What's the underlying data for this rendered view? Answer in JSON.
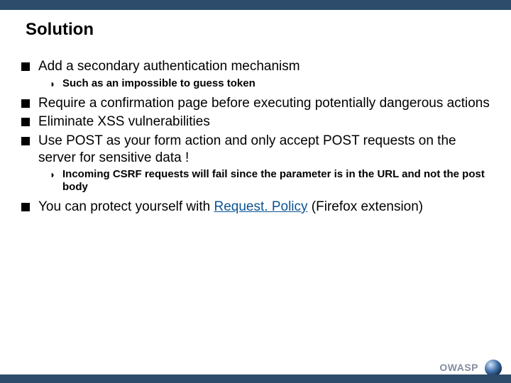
{
  "title": "Solution",
  "bullets": [
    {
      "text": "Add a secondary authentication mechanism",
      "sub": [
        "Such as an impossible to guess token"
      ]
    },
    {
      "text": "Require a confirmation page before executing potentially dangerous actions",
      "sub": []
    },
    {
      "text": "Eliminate XSS vulnerabilities",
      "sub": []
    },
    {
      "text": "Use POST as your form action and only accept POST requests on the server for sensitive data !",
      "sub": [
        "Incoming CSRF requests will fail since the parameter is in the URL and not the post body"
      ]
    },
    {
      "text_before": "You can protect yourself with ",
      "link_text": "Request. Policy",
      "text_after": " (Firefox extension)",
      "sub": []
    }
  ],
  "footer": {
    "brand": "OWASP"
  }
}
